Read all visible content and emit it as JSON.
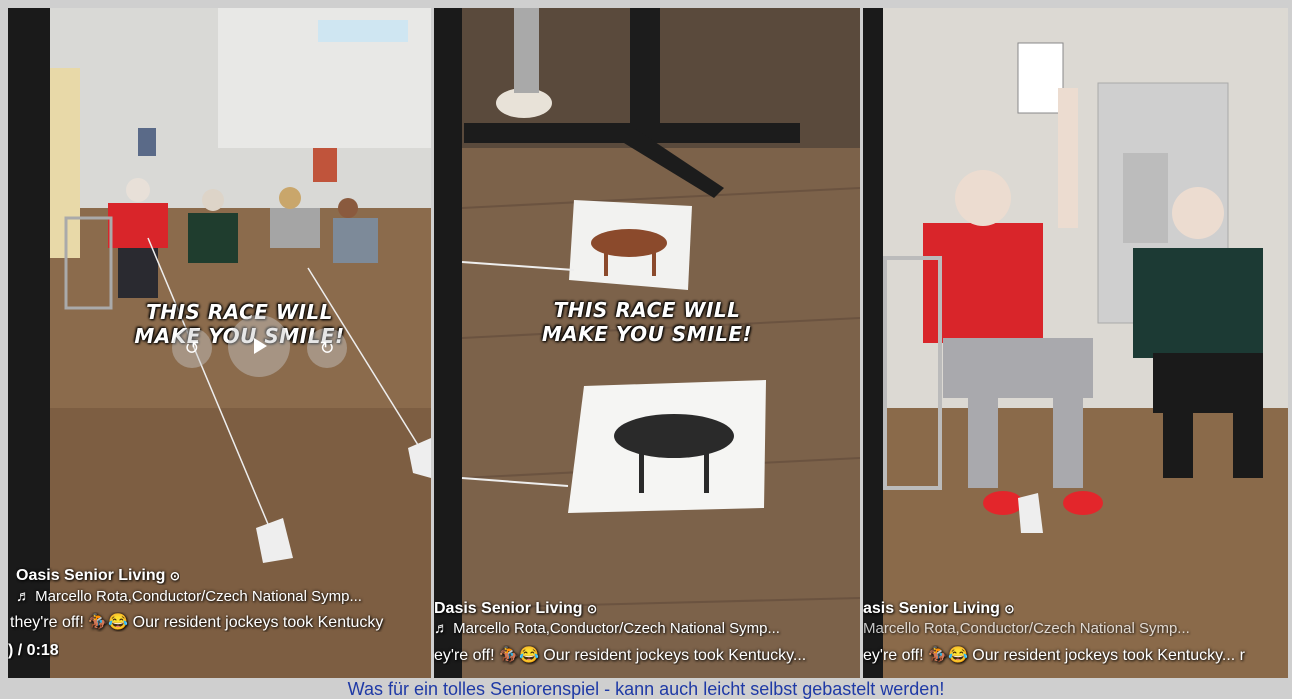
{
  "video_overlay": {
    "caption": "THIS RACE WILL MAKE YOU SMILE!",
    "caption_line1": "THIS RACE WILL",
    "caption_line2": "MAKE YOU SMILE!",
    "panel1_caption_line2": "MAKE YOU SMILE!"
  },
  "panel1": {
    "account": "Oasis Senior Living",
    "music": "♬ Marcello Rota,Conductor/Czech National Symp...",
    "description": "they're off! 🏇😂 Our resident jockeys took Kentucky",
    "time": ") / 0:18"
  },
  "panel2": {
    "account": "Dasis Senior Living",
    "music": "♬ Marcello Rota,Conductor/Czech National Symp...",
    "description": "ey're off! 🏇😂 Our resident jockeys took Kentucky...",
    "time_fragment": "<"
  },
  "panel3": {
    "account": "asis Senior Living",
    "music": "Marcello Rota,Conductor/Czech National Symp...",
    "description": "ey're off! 🏇😂 Our resident jockeys took Kentucky... r"
  },
  "icons": {
    "verified": "verified-badge-icon",
    "play": "play-icon",
    "rewind": "rewind-icon",
    "forward": "forward-icon",
    "music": "music-note-icon"
  },
  "footer": {
    "caption": "Was für ein tolles Seniorenspiel - kann auch leicht selbst gebastelt werden!"
  },
  "colors": {
    "footer_text": "#1f3aa6",
    "shirt_red": "#d9252a",
    "floor": "#8a6a4a"
  }
}
